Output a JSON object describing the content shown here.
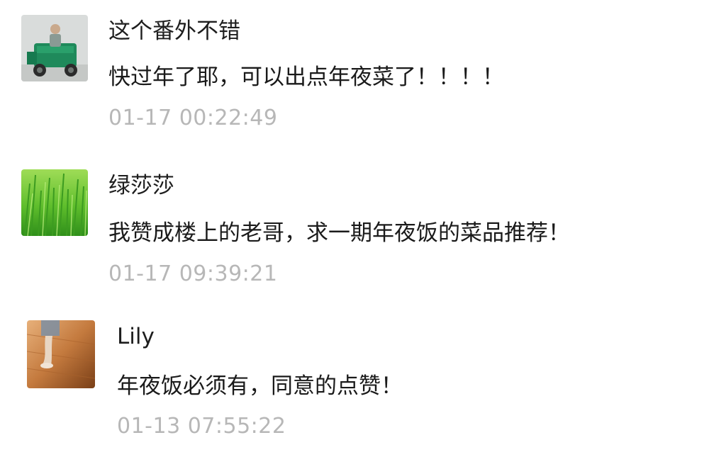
{
  "comments": [
    {
      "author": "这个番外不错",
      "text": "快过年了耶，可以出点年夜菜了！！！！",
      "time": "01-17 00:22:49",
      "avatar_icon": "man-on-green-tricycle-photo"
    },
    {
      "author": "绿莎莎",
      "text": "我赞成楼上的老哥，求一期年夜饭的菜品推荐！",
      "time": "01-17 09:39:21",
      "avatar_icon": "green-grass-photo"
    },
    {
      "author": "Lily",
      "text": "年夜饭必须有，同意的点赞！",
      "time": "01-13 07:55:22",
      "avatar_icon": "feet-on-wood-floor-photo"
    }
  ]
}
